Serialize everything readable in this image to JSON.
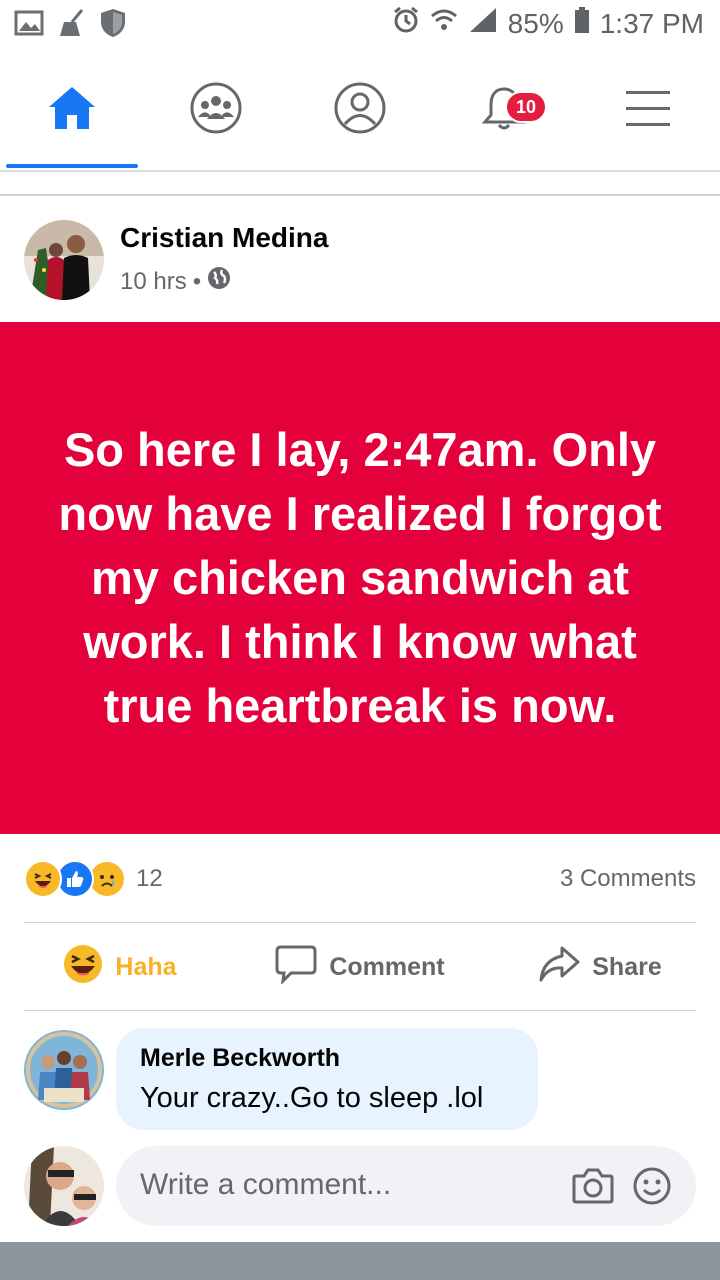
{
  "status_bar": {
    "battery": "85%",
    "time": "1:37 PM"
  },
  "nav": {
    "notification_badge": "10",
    "active_tab": "home"
  },
  "post": {
    "author": "Cristian Medina",
    "time": "10 hrs",
    "separator": "•",
    "text": "So here I lay, 2:47am. Only now have I realized I forgot my chicken sandwich at work. I think I know what true heartbreak is now.",
    "background_color": "#e4003a",
    "reactions_count": "12",
    "comments_count": "3 Comments"
  },
  "actions": {
    "haha_label": "Haha",
    "comment_label": "Comment",
    "share_label": "Share"
  },
  "comment": {
    "author": "Merle Beckworth",
    "text": "Your crazy..Go to sleep .lol"
  },
  "write_comment": {
    "placeholder": "Write a comment..."
  },
  "colors": {
    "accent": "#1877f2",
    "badge": "#e41e3f",
    "haha": "#f7b125"
  }
}
